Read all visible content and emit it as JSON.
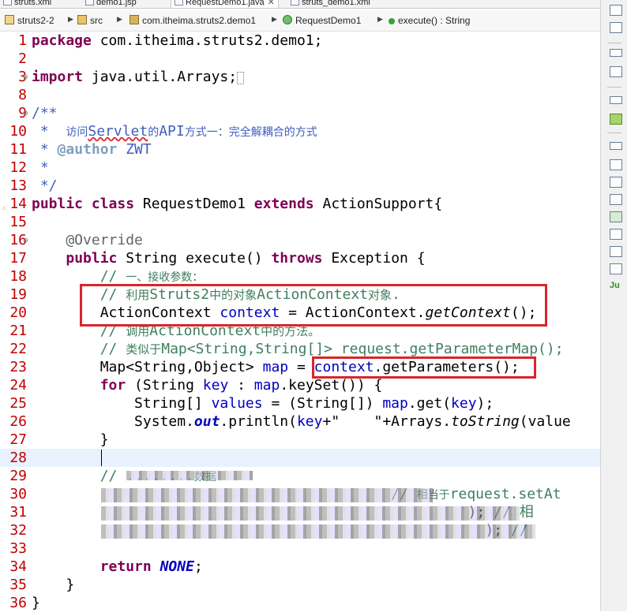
{
  "tabs": [
    {
      "label": "struts.xml",
      "active": false
    },
    {
      "label": "demo1.jsp",
      "active": false
    },
    {
      "label": "RequestDemo1.java",
      "active": true
    },
    {
      "label": "struts_demo1.xml",
      "active": false
    }
  ],
  "breadcrumb": [
    "struts2-2",
    "src",
    "com.itheima.struts2.demo1",
    "RequestDemo1",
    "execute() : String"
  ],
  "lines": [
    {
      "n": "1",
      "text": "package com.itheima.struts2.demo1;"
    },
    {
      "n": "2",
      "text": ""
    },
    {
      "n": "3",
      "text": "import java.util.Arrays;"
    },
    {
      "n": "8",
      "text": ""
    },
    {
      "n": "9",
      "text": "/**"
    },
    {
      "n": "10",
      "text": " * 访问Servlet的API方式一：完全解耦合的方式"
    },
    {
      "n": "11",
      "text": " * @author ZWT"
    },
    {
      "n": "12",
      "text": " *"
    },
    {
      "n": "13",
      "text": " */"
    },
    {
      "n": "14",
      "text": "public class RequestDemo1 extends ActionSupport{"
    },
    {
      "n": "15",
      "text": ""
    },
    {
      "n": "16",
      "text": "    @Override"
    },
    {
      "n": "17",
      "text": "    public String execute() throws Exception {"
    },
    {
      "n": "18",
      "text": "        // 一、接收参数："
    },
    {
      "n": "19",
      "text": "        // 利用Struts2中的对象ActionContext对象."
    },
    {
      "n": "20",
      "text": "        ActionContext context = ActionContext.getContext();"
    },
    {
      "n": "21",
      "text": "        // 调用ActionContext中的方法。"
    },
    {
      "n": "22",
      "text": "        // 类似于Map<String,String[]> request.getParameterMap();"
    },
    {
      "n": "23",
      "text": "        Map<String,Object> map = context.getParameters();"
    },
    {
      "n": "24",
      "text": "        for (String key : map.keySet()) {"
    },
    {
      "n": "25",
      "text": "            String[] values = (String[]) map.get(key);"
    },
    {
      "n": "26",
      "text": "            System.out.println(key+\"    \"+Arrays.toString(value"
    },
    {
      "n": "27",
      "text": "        }"
    },
    {
      "n": "28",
      "text": ""
    },
    {
      "n": "29",
      "text": "        // ...数据"
    },
    {
      "n": "30",
      "text": "        context.put(\"reqName\", \"reqValue\"); // 相当于request.setAt"
    },
    {
      "n": "31",
      "text": "        context.getSession().put(\"sessName\", \"sessValue\"); // 相"
    },
    {
      "n": "32",
      "text": "        context.getApplication().put(\"appName\", \"appValue\"); //"
    },
    {
      "n": "33",
      "text": ""
    },
    {
      "n": "34",
      "text": "        return NONE;"
    },
    {
      "n": "35",
      "text": "    }"
    },
    {
      "n": "36",
      "text": "}"
    }
  ],
  "colors": {
    "keyword": "#7f0055",
    "comment": "#3f7f5f",
    "javadoc": "#3f5fbf",
    "highlight_box": "#d9252a",
    "line_number": "#c00000"
  },
  "right_toolbar_icons": [
    "outline-icon",
    "restore-icon",
    "hierarchy-icon",
    "restore-icon",
    "task-icon",
    "restore-icon",
    "problems-icon",
    "javadoc-icon",
    "declaration-icon",
    "console-icon",
    "servers-icon",
    "data-icon",
    "progress-icon",
    "junit-icon"
  ]
}
